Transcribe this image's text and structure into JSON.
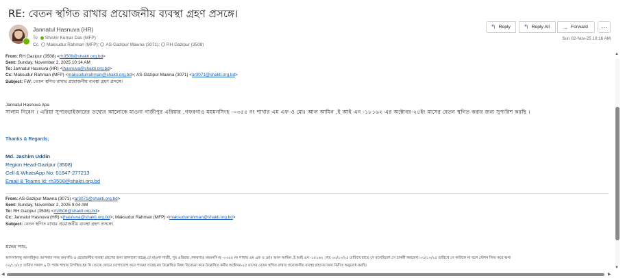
{
  "email": {
    "subject": "RE: বেতন স্থগিত রাখার প্রয়োজনীয় ব্যবস্থা গ্রহণ প্রসঙ্গে।",
    "sender": "Jannatul Hasnuva (HR)",
    "to_label": "To",
    "to_name": "Shishir Kumar Das (MFP)",
    "cc_label": "Cc",
    "cc_1": "Maksudur Rahman (MFP);",
    "cc_2": "AS-Gazipur Mawna (3071);",
    "cc_3": "RH Gazipur (3508)",
    "date": "Sun 02-Nov-25 10:16 AM"
  },
  "actions": {
    "reply": "Reply",
    "reply_all": "Reply All",
    "forward": "Forward",
    "more": "···"
  },
  "quote1": {
    "from_label": "From:",
    "from_text": "RH Gazipur (3508) <",
    "from_email": "rh3508@shakti.org.bd",
    "from_end": ">",
    "sent_label": "Sent:",
    "sent_text": "Sunday, November 2, 2025 10:14 AM",
    "to_label": "To:",
    "to_text": "Jannatul Hasnuva (HR) <",
    "to_email": "jhasnuva@shakti.org.bd",
    "to_end": ">",
    "cc_label": "Cc:",
    "cc_text": "Maksudur Rahman (MFP) <",
    "cc_email": "maksudurrahman@shakti.org.bd",
    "cc_mid": ">; AS-Gazipur Mawna (3071) <",
    "cc_email2": "ar3071@shakti.org.bd",
    "cc_end": ">",
    "subject_label": "Subject:",
    "subject_text": "FW: বেতন স্থগিত রাখার প্রয়োজনীয় ব্যবস্থা গ্রহণ প্রসঙ্গে।",
    "greeting": "Jannatul Hasnuva Apa",
    "body": "সালাম নিবেন । এরিয়া সুপারভাইজারের তথ্যের আলোকে মাওনা গাজীপুর এরিয়ার ,গফরগাও ময়মনসিংহ -০৩৫৫ নং শাখার এম এফ ও মোঃ আল আমিন ,ই আই এন -১৮১৬২ এর অক্টোবর-২৫ইং মাসের বেতন স্থগিত করার জন্য সুপারিশ করছি ।"
  },
  "signature": {
    "thanks": "Thanks & Regards,",
    "name": "Md. Jashim Uddin",
    "role": "Region Head-Gazipur (3508)",
    "phone": "Cell & WhatsApp No: 01847-277213",
    "teams": "Email & Teams Id: rh3508@shakti.org.bd"
  },
  "quote2": {
    "from_label": "From:",
    "from_text": "AS-Gazipur Mawna (3071) <",
    "from_email": "ar3071@shakti.org.bd",
    "from_end": ">",
    "sent_label": "Sent:",
    "sent_text": "Sunday, November 2, 2025 9:04 AM",
    "to_label": "To:",
    "to_text": "RH Gazipur (3508) <",
    "to_email": "rh3508@shakti.org.bd",
    "to_end": ">",
    "cc_label": "Cc:",
    "cc_text": "Jannatul Hasnuva (HR) <",
    "cc_email": "jhasnuva@shakti.org.bd",
    "cc_mid": ">; Maksudur Rahman (MFP) <",
    "cc_email2": "maksudurrahman@shakti.org.bd",
    "cc_end": ">",
    "subject_label": "Subject:",
    "subject_text": "বেতন স্থগিত রাখার প্রয়োজনীয় ব্যবস্থা গ্রহণ প্রসঙ্গে।",
    "greeting": "শ্রদ্ধেয় স্যার,",
    "body1": "আসসালামু আলাইকুম। আপনার সদয় অবগতি ও প্রয়োজনীয় ব্যবস্থা গ্রহণের জন্য জানানো যাচ্ছে যে মাওনা গাজী, পুর এরিয়ার ,গফরগাও ময়মনসিংহ -০৩৫৫ নং শাখার এম এফ ও মোঃ আল আমিন ,ই আই এন -১৮১৬২ ,গত ৩০/১০/২৫ তারিখে রাতে সে বলেছিলো সে চাকরী করবেনা। ৩১/১০/২৫ তারিখে সে কাউকে না বলে স্টেশন লিভ করে অন্য",
    "body2": "০২/১১/২৫ তারিখ সকাল ৯ টা পর্যন্ত শাখায় উপস্থিত হয় নি। তাকে ফোনে যোগাযোগ করে পাওয়া যাচ্ছে না। উল্লেখিত বিষয় বিবেচনা করে উল্লেখিত কর্মীর অক্টোবর-২৫ মাসের বেতন স্থগিত রাখার প্রয়োজনীয় ব্যবস্থা গ্রহণের জন্য বিনীত অনুরোধ করছি।"
  },
  "icons": {
    "reply": "reply-arrow-icon",
    "reply_all": "reply-all-icon",
    "forward": "forward-arrow-icon",
    "more": "more-icon",
    "presence": "presence-available-icon"
  },
  "colors": {
    "link": "#1a5fb4",
    "signature": "#1f4e79",
    "thanks": "#2e75b6",
    "presence": "#6bb700",
    "action_icon": "#3b6fd4"
  }
}
